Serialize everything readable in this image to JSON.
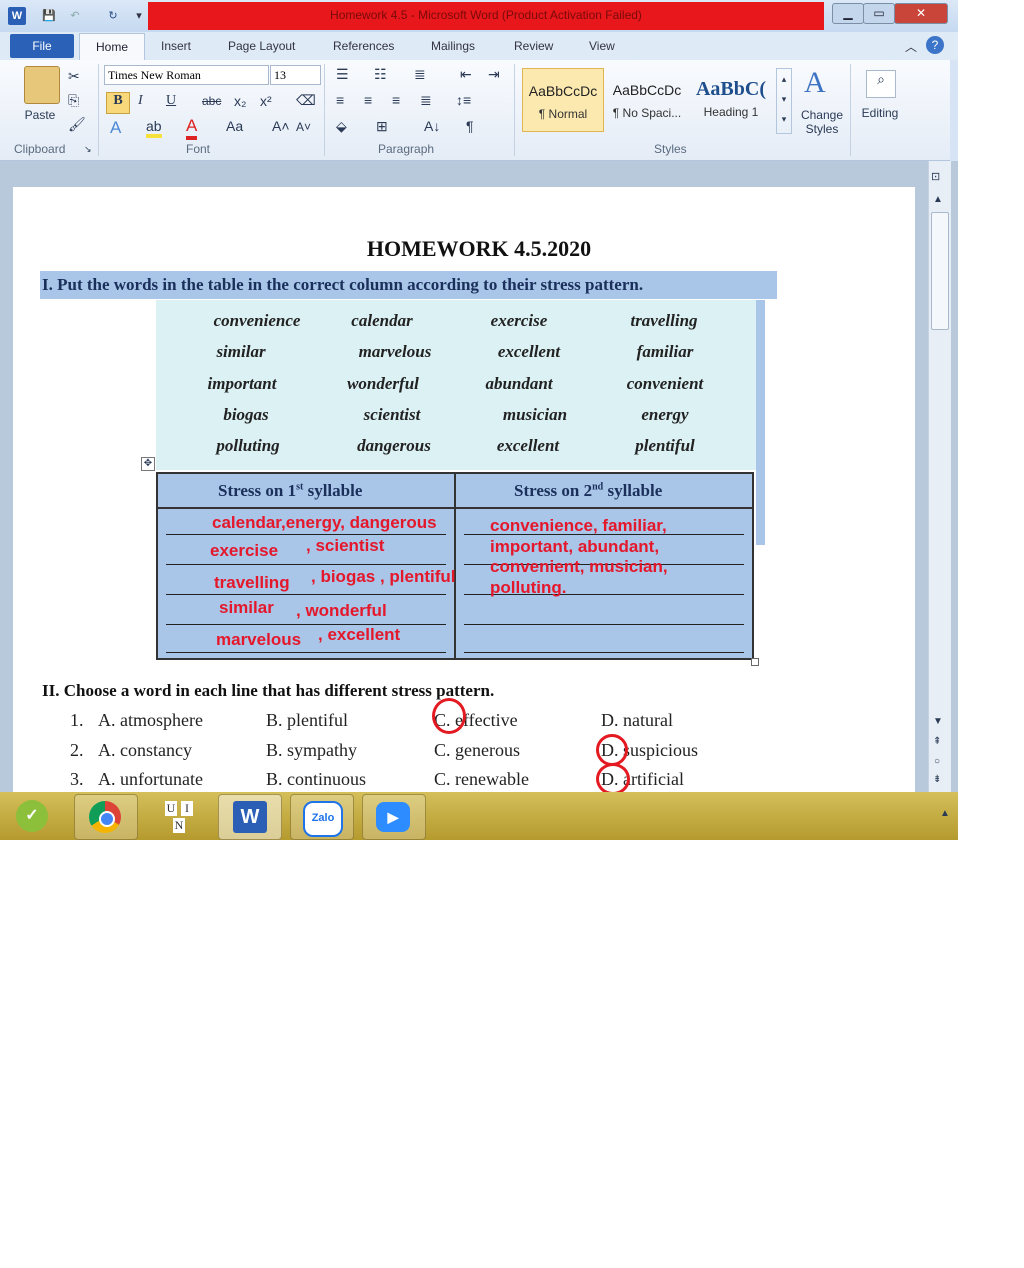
{
  "window": {
    "title": "Homework 4.5 - Microsoft Word (Product Activation Failed)",
    "controls": [
      "minimize",
      "maximize",
      "close"
    ]
  },
  "tabs": [
    "File",
    "Home",
    "Insert",
    "Page Layout",
    "References",
    "Mailings",
    "Review",
    "View"
  ],
  "ribbon": {
    "clipboard": {
      "label": "Clipboard",
      "paste": "Paste"
    },
    "font": {
      "label": "Font",
      "family": "Times New Roman",
      "size": "13"
    },
    "paragraph": {
      "label": "Paragraph"
    },
    "styles": {
      "label": "Styles",
      "items": [
        {
          "preview": "AaBbCcDc",
          "name": "¶ Normal"
        },
        {
          "preview": "AaBbCcDc",
          "name": "¶ No Spaci..."
        },
        {
          "preview": "AaBbC(",
          "name": "Heading 1"
        }
      ],
      "change_styles": "Change Styles",
      "editing": "Editing"
    }
  },
  "document": {
    "title": "HOMEWORK  4.5.2020",
    "section1": {
      "instruction": "I.   Put the words in the table in the correct column according to their stress pattern.",
      "words": [
        [
          "convenience",
          "calendar",
          "exercise",
          "travelling"
        ],
        [
          "similar",
          "marvelous",
          "excellent",
          "familiar"
        ],
        [
          "important",
          "wonderful",
          "abundant",
          "convenient"
        ],
        [
          "biogas",
          "scientist",
          "musician",
          "energy"
        ],
        [
          "polluting",
          "dangerous",
          "excellent",
          "plentiful"
        ]
      ],
      "col1_header": "Stress on 1st syllable",
      "col2_header": "Stress on 2nd syllable",
      "col1_answers": [
        [
          "calendar,energy, dangerous"
        ],
        [
          "exercise",
          ", scientist"
        ],
        [
          "travelling",
          ", biogas , plentiful"
        ],
        [
          "similar",
          ", wonderful"
        ],
        [
          "marvelous",
          ", excellent"
        ]
      ],
      "col2_answers": [
        "convenience, familiar,",
        "important, abundant,",
        "convenient, musician,",
        "polluting."
      ]
    },
    "section2": {
      "instruction": "II.  Choose a word in each line that has different stress pattern.",
      "questions": [
        {
          "num": "1.",
          "options": [
            "A. atmosphere",
            "B. plentiful",
            "C. effective",
            "D. natural"
          ],
          "circled": "C"
        },
        {
          "num": "2.",
          "options": [
            "A. constancy",
            "B. sympathy",
            "C. generous",
            "D. suspicious"
          ],
          "circled": "D"
        },
        {
          "num": "3.",
          "options": [
            "A. unfortunate",
            "B. continuous",
            "C. renewable",
            "D. artificial"
          ],
          "circled": "D"
        }
      ]
    }
  },
  "taskbar": {
    "apps": [
      "start-orb",
      "chrome",
      "unikey",
      "word",
      "zalo",
      "zoom"
    ],
    "unikey_text": [
      "U",
      "I",
      "N"
    ],
    "zalo_text": "Zalo"
  },
  "colors": {
    "title_red": "#e8171b",
    "answer_red": "#e4172b",
    "highlight_blue": "#a9c6e8",
    "wordbox": "#dcf1f4"
  }
}
